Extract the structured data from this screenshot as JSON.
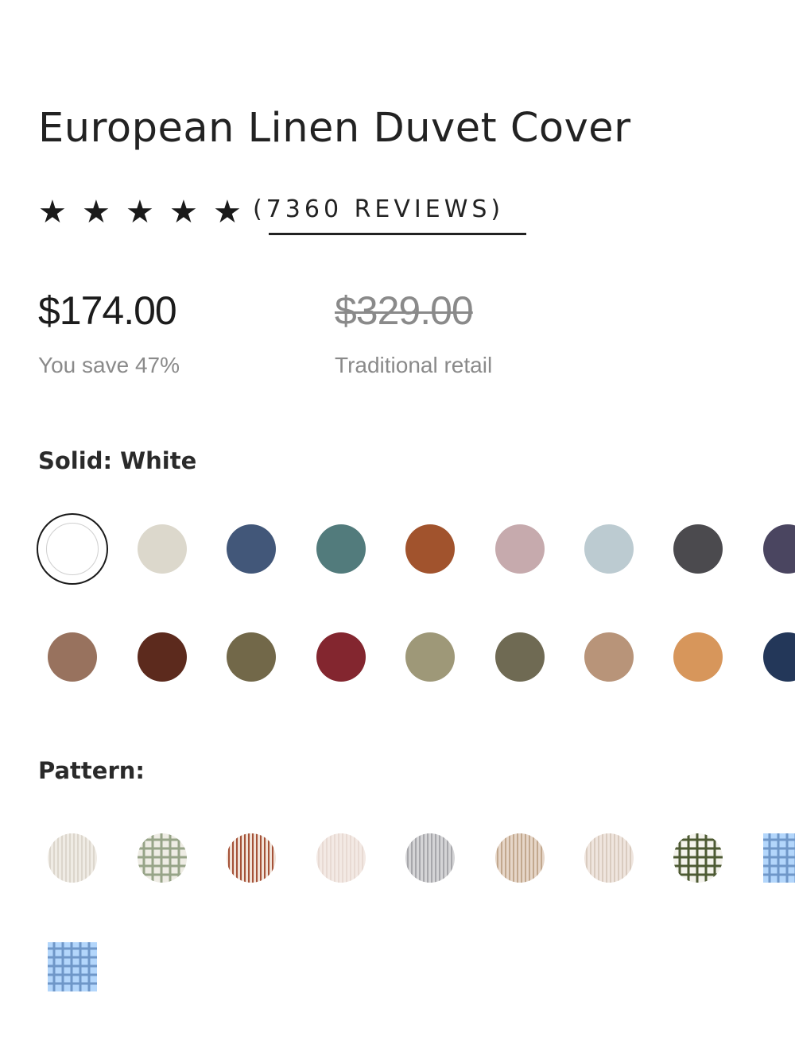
{
  "product": {
    "title": "European Linen Duvet Cover",
    "rating_stars": 5,
    "reviews_text": "(7360 REVIEWS)",
    "price": "$174.00",
    "savings": "You save 47%",
    "retail_price": "$329.00",
    "retail_label": "Traditional retail"
  },
  "solid": {
    "label": "Solid:",
    "selected_value": "White",
    "colors_row1": [
      "#ffffff",
      "#dcd8cc",
      "#425779",
      "#527b7c",
      "#a1532d",
      "#c6aaad",
      "#bccbd1",
      "#4b4a4e",
      "#4a4560"
    ],
    "colors_row2": [
      "#98725e",
      "#5c2a1d",
      "#726849",
      "#83262f",
      "#9e9878",
      "#6f6a53",
      "#b89479",
      "#d7965b",
      "#233759"
    ]
  },
  "pattern": {
    "label": "Pattern:",
    "swatches": [
      {
        "icon": "stripe-pattern",
        "base": "#efebe4",
        "line": "#dcd6cc"
      },
      {
        "icon": "grid-pattern",
        "base": "#eeece4",
        "line": "#97a488"
      },
      {
        "icon": "stripe-pattern",
        "base": "#f1e2d8",
        "line": "#a55238"
      },
      {
        "icon": "stripe-pattern",
        "base": "#f3e9e4",
        "line": "#e8dad3"
      },
      {
        "icon": "stripe-pattern",
        "base": "#d4d4d6",
        "line": "#a7a7ab"
      },
      {
        "icon": "stripe-pattern",
        "base": "#e6d6c8",
        "line": "#c2a88e"
      },
      {
        "icon": "stripe-pattern",
        "base": "#efe5de",
        "line": "#d9cbbf"
      },
      {
        "icon": "grid-pattern",
        "base": "#f4f3ec",
        "line": "#4d5a33"
      },
      {
        "icon": "grid-pattern",
        "base": "#a7cdf7",
        "line": "#6f97c8"
      },
      {
        "icon": "grid-pattern",
        "base": "#a7cdf7",
        "line": "#6f97c8"
      }
    ]
  }
}
